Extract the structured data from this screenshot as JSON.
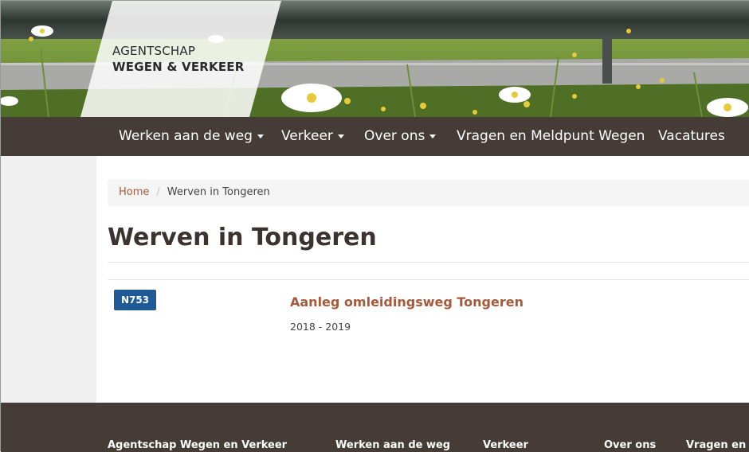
{
  "logo": {
    "line1": "AGENTSCHAP",
    "line2": "WEGEN & VERKEER"
  },
  "nav": {
    "items": [
      {
        "label": "Werken aan de weg",
        "dropdown": true
      },
      {
        "label": "Verkeer",
        "dropdown": true
      },
      {
        "label": "Over ons",
        "dropdown": true
      },
      {
        "label": "Vragen en Meldpunt Wegen",
        "dropdown": false
      },
      {
        "label": "Vacatures",
        "dropdown": false
      }
    ]
  },
  "breadcrumb": {
    "home": "Home",
    "separator": "/",
    "current": "Werven in Tongeren"
  },
  "page": {
    "title": "Werven in Tongeren"
  },
  "projects": [
    {
      "road": "N753",
      "title": "Aanleg omleidingsweg Tongeren",
      "years": "2018 - 2019"
    }
  ],
  "footer": {
    "columns": [
      "Agentschap Wegen en Verkeer",
      "Werken aan de weg",
      "Verkeer",
      "Over ons",
      "Vragen en Me"
    ]
  },
  "colors": {
    "nav_bg": "#463c37",
    "link": "#a45a3b",
    "badge": "#1f5a96",
    "sidebar": "#f0f0f0"
  },
  "icons": {
    "dropdown": "caret-down-icon"
  }
}
